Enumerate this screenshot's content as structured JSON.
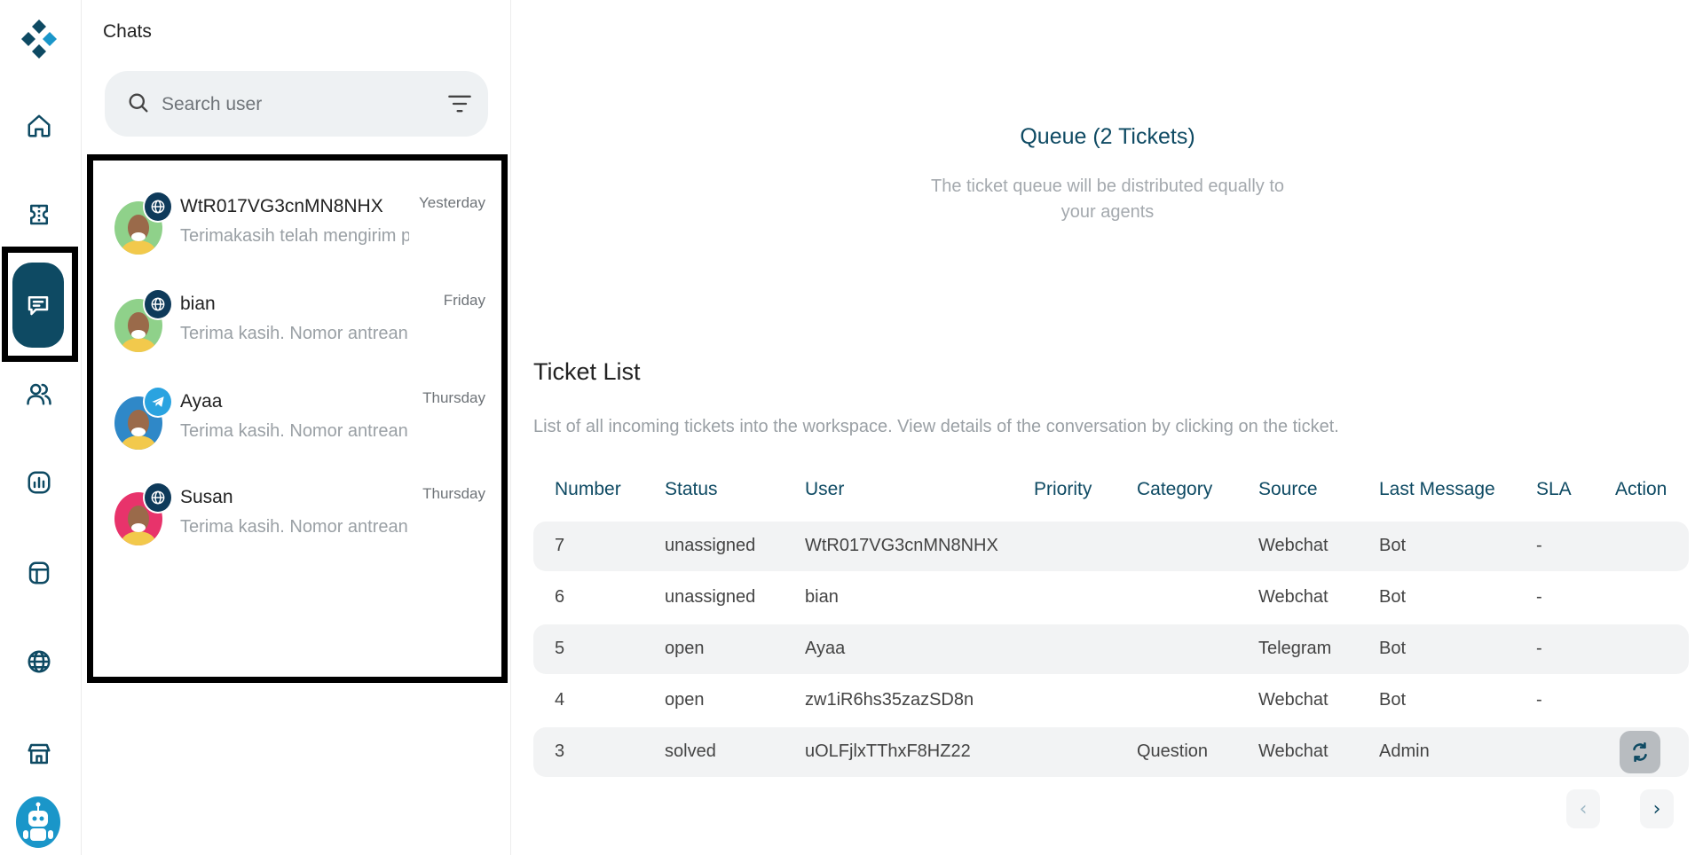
{
  "sidebar": {
    "items": [
      {
        "icon": "home-icon"
      },
      {
        "icon": "ticket-icon"
      },
      {
        "icon": "chat-icon",
        "active": true
      },
      {
        "icon": "users-icon"
      },
      {
        "icon": "report-icon"
      },
      {
        "icon": "template-icon"
      },
      {
        "icon": "globe-icon"
      },
      {
        "icon": "store-icon"
      }
    ],
    "active_color": "#0e4a63"
  },
  "chats": {
    "title": "Chats",
    "search_placeholder": "Search user",
    "items": [
      {
        "name": "WtR017VG3cnMN8NHX",
        "time": "Yesterday",
        "preview": "Terimakasih telah mengirim pesan",
        "channel": "webchat"
      },
      {
        "name": "bian",
        "time": "Friday",
        "preview": "Terima kasih. Nomor antrean Anda",
        "channel": "webchat"
      },
      {
        "name": "Ayaa",
        "time": "Thursday",
        "preview": "Terima kasih. Nomor antrean A",
        "channel": "telegram"
      },
      {
        "name": "Susan",
        "time": "Thursday",
        "preview": "Terima kasih. Nomor antrean A",
        "channel": "webchat"
      }
    ]
  },
  "queue": {
    "title": "Queue (2 Tickets)",
    "description": "The ticket queue will be distributed equally to your agents"
  },
  "tickets": {
    "title": "Ticket List",
    "description": "List of all incoming tickets into the workspace. View details of the conversation by clicking on the ticket.",
    "columns": [
      "Number",
      "Status",
      "User",
      "Priority",
      "Category",
      "Source",
      "Last Message",
      "SLA",
      "Action"
    ],
    "rows": [
      {
        "number": "7",
        "status": "unassigned",
        "user": "WtR017VG3cnMN8NHX",
        "priority": "",
        "category": "",
        "source": "Webchat",
        "last_message": "Bot",
        "sla": "-",
        "action": ""
      },
      {
        "number": "6",
        "status": "unassigned",
        "user": "bian",
        "priority": "",
        "category": "",
        "source": "Webchat",
        "last_message": "Bot",
        "sla": "-",
        "action": ""
      },
      {
        "number": "5",
        "status": "open",
        "user": "Ayaa",
        "priority": "",
        "category": "",
        "source": "Telegram",
        "last_message": "Bot",
        "sla": "-",
        "action": ""
      },
      {
        "number": "4",
        "status": "open",
        "user": "zw1iR6hs35zazSD8n",
        "priority": "",
        "category": "",
        "source": "Webchat",
        "last_message": "Bot",
        "sla": "-",
        "action": ""
      },
      {
        "number": "3",
        "status": "solved",
        "user": "uOLFjlxTThxF8HZ22",
        "priority": "",
        "category": "Question",
        "source": "Webchat",
        "last_message": "Admin",
        "sla": "",
        "action": "reopen-icon"
      }
    ]
  },
  "pagination": {
    "prev": "‹",
    "next": "›"
  }
}
